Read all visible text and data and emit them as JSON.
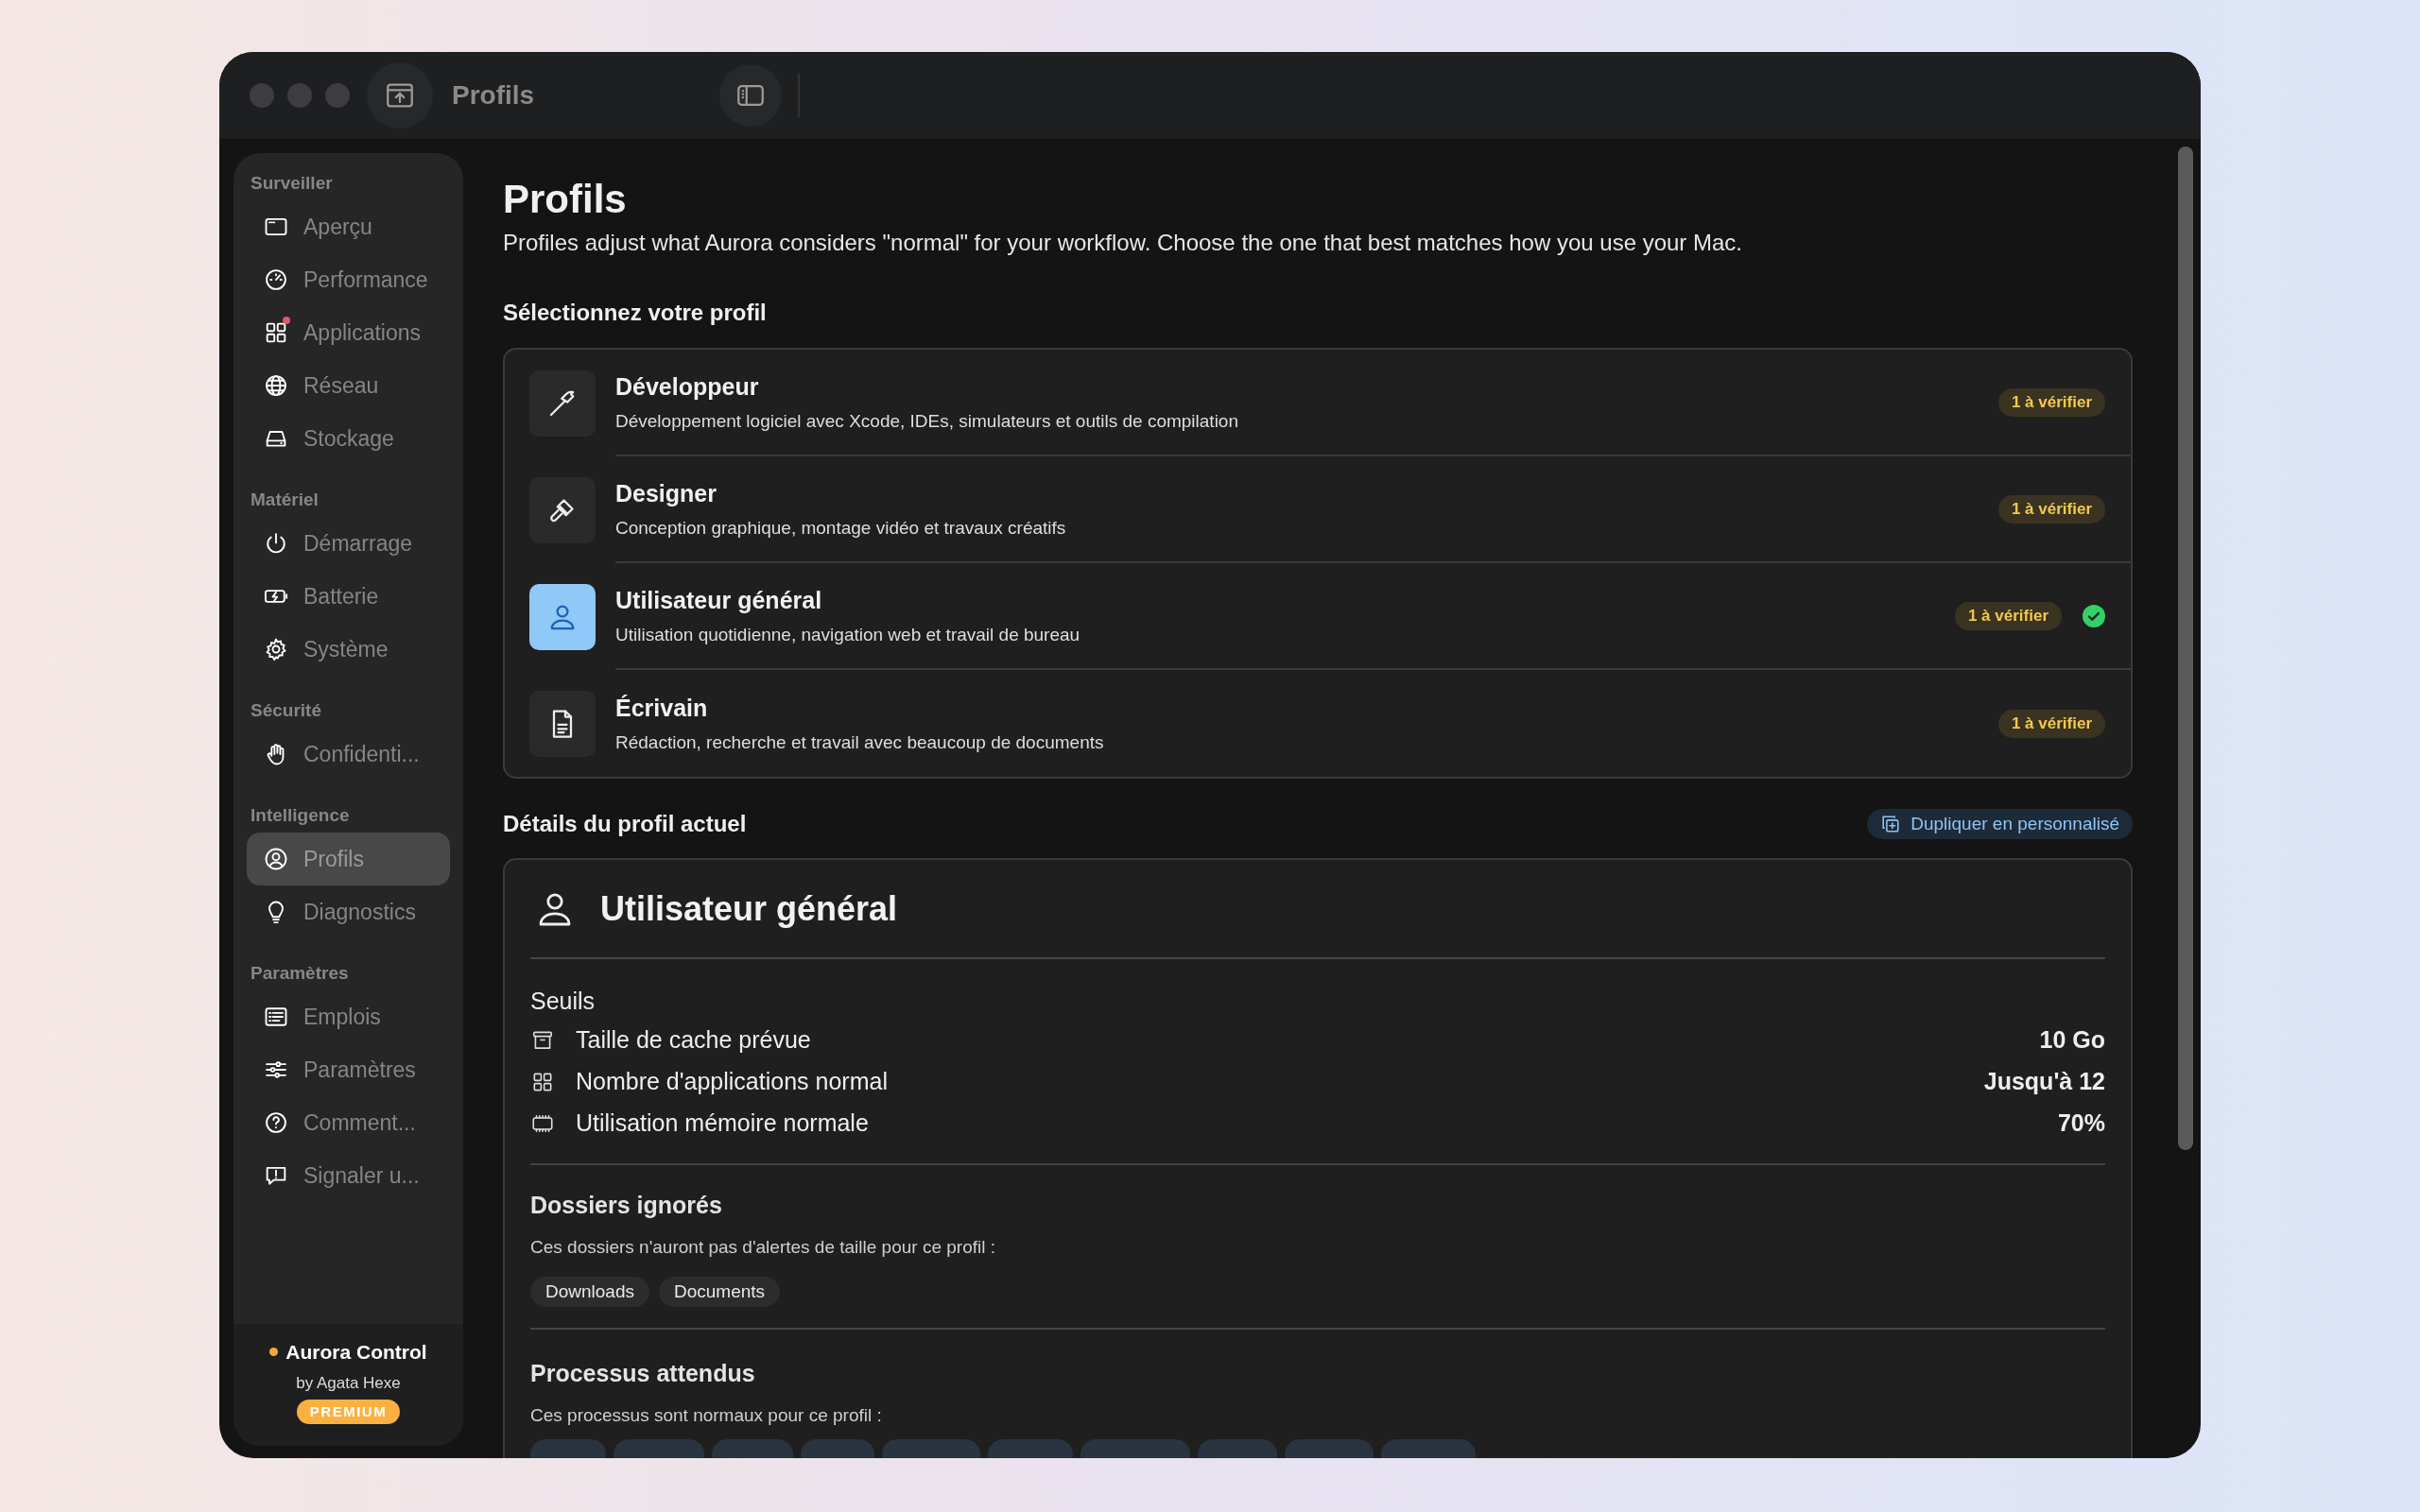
{
  "window": {
    "title": "Profils"
  },
  "sidebar": {
    "sections": [
      {
        "title": "Surveiller",
        "items": [
          {
            "label": "Aperçu",
            "selected": false,
            "notification": false
          },
          {
            "label": "Performance",
            "selected": false,
            "notification": false
          },
          {
            "label": "Applications",
            "selected": false,
            "notification": true
          },
          {
            "label": "Réseau",
            "selected": false,
            "notification": false
          },
          {
            "label": "Stockage",
            "selected": false,
            "notification": false
          }
        ]
      },
      {
        "title": "Matériel",
        "items": [
          {
            "label": "Démarrage",
            "selected": false,
            "notification": false
          },
          {
            "label": "Batterie",
            "selected": false,
            "notification": false
          },
          {
            "label": "Système",
            "selected": false,
            "notification": false
          }
        ]
      },
      {
        "title": "Sécurité",
        "items": [
          {
            "label": "Confidenti...",
            "selected": false,
            "notification": false
          }
        ]
      },
      {
        "title": "Intelligence",
        "items": [
          {
            "label": "Profils",
            "selected": true,
            "notification": false
          },
          {
            "label": "Diagnostics",
            "selected": false,
            "notification": false
          }
        ]
      },
      {
        "title": "Paramètres",
        "items": [
          {
            "label": "Emplois",
            "selected": false,
            "notification": false
          },
          {
            "label": "Paramètres",
            "selected": false,
            "notification": false
          },
          {
            "label": "Comment...",
            "selected": false,
            "notification": false
          },
          {
            "label": "Signaler u...",
            "selected": false,
            "notification": false
          }
        ]
      }
    ],
    "footer": {
      "app_name": "Aurora Control",
      "author": "by Agata Hexe",
      "badge": "PREMIUM"
    }
  },
  "main": {
    "title": "Profils",
    "subtitle": "Profiles adjust what Aurora considers \"normal\" for your workflow. Choose the one that best matches how you use your Mac.",
    "profiles_heading": "Sélectionnez votre profil",
    "profiles": [
      {
        "name": "Développeur",
        "description": "Développement logiciel avec Xcode, IDEs, simulateurs et outils de compilation",
        "badge": "1 à vérifier",
        "selected": false
      },
      {
        "name": "Designer",
        "description": "Conception graphique, montage vidéo et travaux créatifs",
        "badge": "1 à vérifier",
        "selected": false
      },
      {
        "name": "Utilisateur général",
        "description": "Utilisation quotidienne, navigation web et travail de bureau",
        "badge": "1 à vérifier",
        "selected": true
      },
      {
        "name": "Écrivain",
        "description": "Rédaction, recherche et travail avec beaucoup de documents",
        "badge": "1 à vérifier",
        "selected": false
      }
    ],
    "details": {
      "heading": "Détails du profil actuel",
      "action": "Dupliquer en personnalisé",
      "profile_name": "Utilisateur général",
      "thresholds_heading": "Seuils",
      "thresholds": [
        {
          "label": "Taille de cache prévue",
          "value": "10 Go"
        },
        {
          "label": "Nombre d'applications normal",
          "value": "Jusqu'à 12"
        },
        {
          "label": "Utilisation mémoire normale",
          "value": "70%"
        }
      ],
      "ignored": {
        "heading": "Dossiers ignorés",
        "description": "Ces dossiers n'auront pas d'alertes de taille pour ce profil :",
        "folders": [
          "Downloads",
          "Documents"
        ]
      },
      "processes": {
        "heading": "Processus attendus",
        "description": "Ces processus sont normaux pour ce profil :"
      }
    }
  }
}
